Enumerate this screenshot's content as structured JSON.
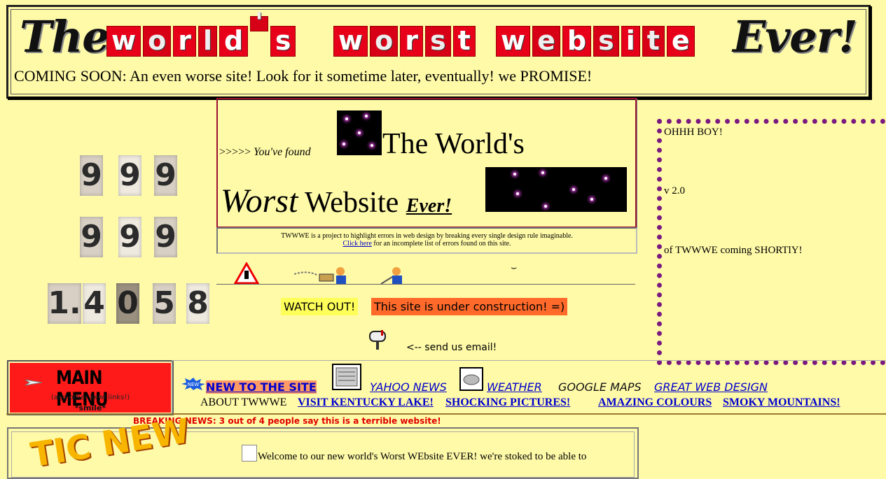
{
  "header": {
    "title_the": "The",
    "title_worlds": [
      "w",
      "o",
      "r",
      "l",
      "d",
      "'",
      "s"
    ],
    "title_worst": [
      "w",
      "o",
      "r",
      "s",
      "t"
    ],
    "title_website": [
      "w",
      "e",
      "b",
      "s",
      "i",
      "t",
      "e"
    ],
    "title_ever": "Ever!",
    "coming_soon": "COMING SOON: An even worse site! Look for it sometime later, eventually!  we PROMISE!"
  },
  "counter": {
    "row1": [
      "9",
      "9",
      "9"
    ],
    "row2": [
      "9",
      "9",
      "9"
    ],
    "row3": [
      "1.",
      "4",
      "0",
      "5",
      "8"
    ]
  },
  "intro": {
    "arrows": ">>>>> ",
    "found": "You've found",
    "title_line1": "The World's",
    "worst": "Worst",
    "website": " Website ",
    "ever": "Ever!"
  },
  "info": {
    "text": "TWWWE is a project to highlight errors in web design by breaking every single design rule imaginable.",
    "click_here": "Click here",
    "text2": " for an incomplete list of errors found on this site."
  },
  "construction": {
    "watch_out": "WATCH OUT!",
    "under_construction": "This site is under construction! =)",
    "send_email": "<-- send us email!"
  },
  "right_box": {
    "line1": "OHHH BOY!",
    "line2": "v 2.0",
    "line3": "of TWWWE coming SHORTlY!"
  },
  "menu": {
    "title": "MAIN MENU",
    "subtitle": "(and other kewl links!)",
    "smile": "*smile*"
  },
  "nav": {
    "new_to_site": "NEW TO THE SITE",
    "yahoo_news": "YAHOO NEWS",
    "weather": "WEATHER",
    "google_maps": "GOOGLE MAPS",
    "great_web_design": "GREAT WEB DESIGN",
    "about": "ABOUT TWWWE",
    "kentucky": "VISIT KENTUCKY LAKE!",
    "shocking": "SHOCKING PICTURES!",
    "colours": "AMAZING COLOURS",
    "smoky": "SMOKY MOUNTAINS!",
    "new_badge": "NEW"
  },
  "breaking_news": "BREAKING NEWS:  3 out of 4 people say this is a terrible website!",
  "welcome": {
    "text": "Welcome to our new world's Worst WEbsite EVER!  we're stoked to be able to",
    "graphic": "TIC NEW"
  },
  "colors": {
    "background": "#fffaa8",
    "ransom_red": "#e8001a",
    "link_blue": "#0000cc",
    "menu_red": "#ff1a1a",
    "dotted_purple": "#7a1a80"
  }
}
